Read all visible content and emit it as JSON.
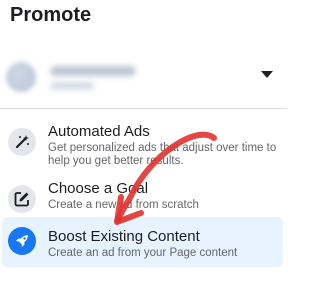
{
  "header": {
    "title": "Promote"
  },
  "account": {
    "selector": "account-dropdown"
  },
  "options": [
    {
      "title": "Automated Ads",
      "description": "Get personalized ads that adjust over time to help you get better results.",
      "icon": "magic-wand-icon"
    },
    {
      "title": "Choose a Goal",
      "description": "Create a new ad from scratch",
      "icon": "edit-icon"
    },
    {
      "title": "Boost Existing Content",
      "description": "Create an ad from your Page content",
      "icon": "rocket-icon"
    }
  ],
  "colors": {
    "accent": "#1877f2",
    "selected_bg": "#e7f3ff",
    "annotation": "#e0322f"
  }
}
